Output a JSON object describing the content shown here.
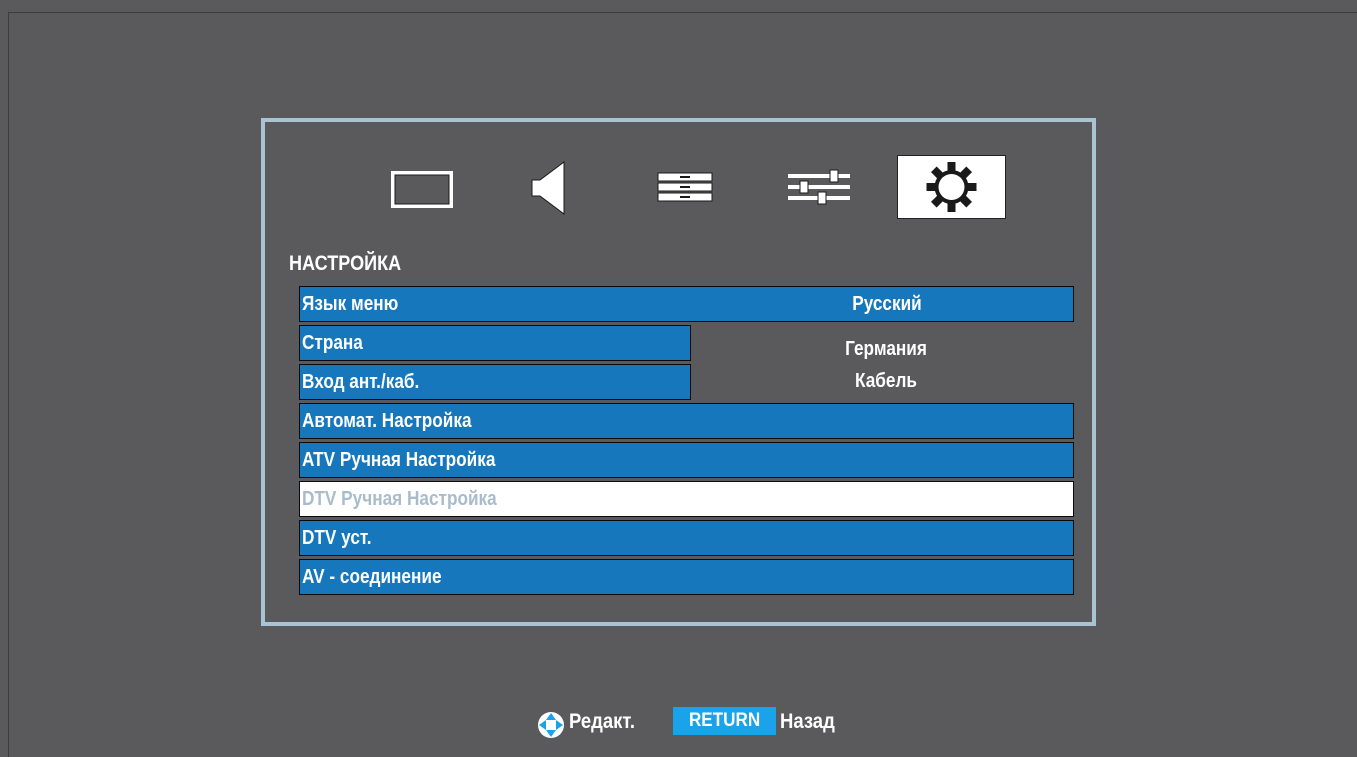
{
  "tabs": [
    {
      "icon": "picture-icon"
    },
    {
      "icon": "sound-icon"
    },
    {
      "icon": "channel-list-icon"
    },
    {
      "icon": "options-sliders-icon"
    },
    {
      "icon": "gear-icon",
      "selected": true
    }
  ],
  "section_title": "НАСТРОЙКА",
  "menu": {
    "language": {
      "label": "Язык меню",
      "value": "Русский"
    },
    "country": {
      "label": "Страна",
      "value": "Германия"
    },
    "input": {
      "label": "Вход ант./каб.",
      "value": "Кабель"
    },
    "auto_tune": {
      "label": "Автомат. Настройка"
    },
    "atv_manual": {
      "label": "ATV Ручная Настройка"
    },
    "dtv_manual": {
      "label": "DTV Ручная Настройка",
      "selected": true
    },
    "dtv_settings": {
      "label": "DTV уст."
    },
    "av_connection": {
      "label": "AV - соединение"
    }
  },
  "footer": {
    "nav_icon": "dpad-icon",
    "edit_label": "Редакт.",
    "return_key": "RETURN",
    "back_label": "Назад"
  },
  "colors": {
    "background": "#5a5a5c",
    "panel_border": "#a8c4d4",
    "row_blue": "#1677bd",
    "selected_row": "#ffffff",
    "selected_text": "#a9bccb",
    "return_key": "#1aa3ea"
  }
}
